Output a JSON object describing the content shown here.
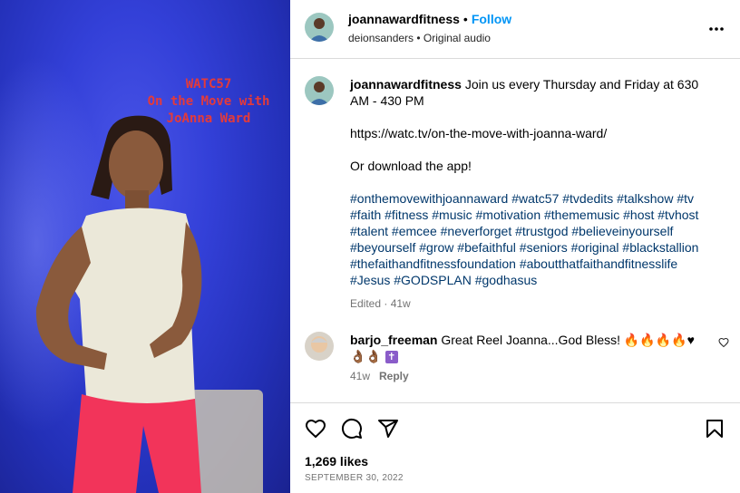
{
  "media": {
    "overlay_lines": [
      "WATC57",
      "On the Move with",
      "JoAnna Ward"
    ]
  },
  "header": {
    "username": "joannawardfitness",
    "separator": "•",
    "follow_label": "Follow",
    "subtitle": "deionsanders • Original audio"
  },
  "caption": {
    "username": "joannawardfitness",
    "text": "Join us every Thursday and Friday at 630 AM - 430 PM",
    "link": "https://watc.tv/on-the-move-with-joanna-ward/",
    "download": "Or download the app!",
    "hashtags": "#onthemovewithjoannaward #watc57 #tvdedits #talkshow #tv #faith #fitness #music #motivation #thememusic #host #tvhost #talent #emcee #neverforget #trustgod #believeinyourself #beyourself #grow #befaithful #seniors #original #blackstallion #thefaithandfitnessfoundation #aboutthatfaithandfitnesslife #Jesus #GODSPLAN #godhasus",
    "edited": "Edited · 41w"
  },
  "comment": {
    "username": "barjo_freeman",
    "text": "Great Reel Joanna...God Bless! 🔥🔥🔥🔥♥👌🏾👌🏾",
    "cross": "✝",
    "time": "41w",
    "reply_label": "Reply"
  },
  "footer": {
    "likes": "1,269 likes",
    "date": "SEPTEMBER 30, 2022"
  },
  "icons": {
    "like": "heart-icon",
    "comment": "comment-bubble-icon",
    "share": "paper-plane-icon",
    "save": "bookmark-icon",
    "more": "more-horizontal-icon"
  },
  "colors": {
    "accent": "#0095f6",
    "hashtag": "#00376b",
    "muted": "#737373",
    "overlay_text": "#e43a3a"
  }
}
